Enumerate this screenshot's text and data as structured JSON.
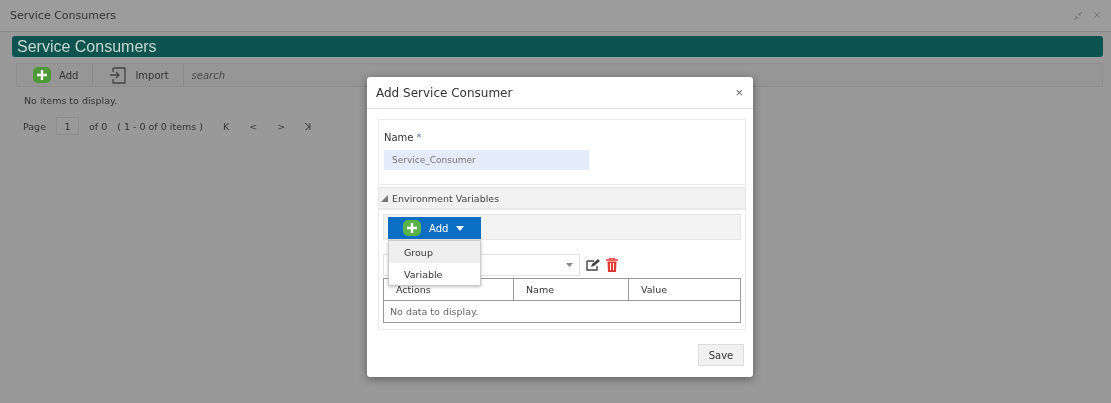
{
  "window": {
    "title": "Service Consumers"
  },
  "header": {
    "title": "Service Consumers"
  },
  "toolbar": {
    "add": "Add",
    "import": "Import",
    "search": {
      "placeholder": "search"
    }
  },
  "empty_message": "No items to display.",
  "pager": {
    "page_label": "Page",
    "page": "1",
    "of": "of 0",
    "range": "( 1 - 0 of 0 items )",
    "first": "K",
    "prev": "<",
    "next": ">",
    "last": "ꓘ"
  },
  "dialog": {
    "title": "Add Service Consumer",
    "close": "×",
    "name": {
      "label": "Name",
      "required": "*",
      "value": "Service_Consumer"
    },
    "section": {
      "title": "Environment Variables",
      "expanded": true
    },
    "add_button": "Add",
    "menu": [
      {
        "label": "Group",
        "selected": true
      },
      {
        "label": "Variable",
        "selected": false
      }
    ],
    "table": {
      "columns": [
        "Actions",
        "Name",
        "Value"
      ],
      "empty": "No data to display."
    },
    "save": "Save"
  }
}
